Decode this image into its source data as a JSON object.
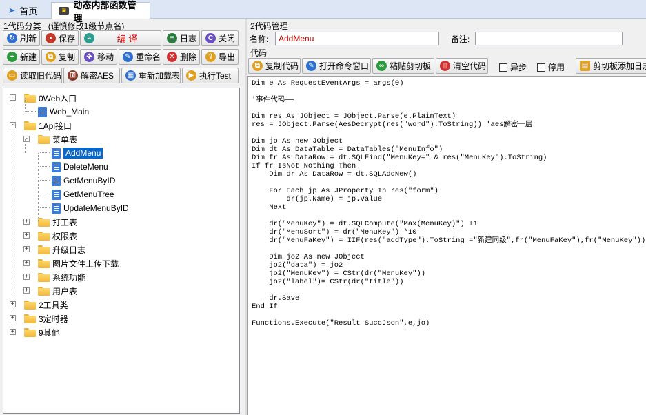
{
  "tabs": [
    {
      "label": "首页",
      "icon": "home-icon"
    },
    {
      "label": "动态内部函数管理",
      "icon": "module-icon"
    }
  ],
  "left": {
    "title": "1代码分类",
    "hint": "(谨慎修改1级节点名)",
    "row1": [
      {
        "label": "刷新",
        "icon": "refresh-icon",
        "color": "#2f6fd0"
      },
      {
        "label": "保存",
        "icon": "save-icon",
        "color": "#c0392b"
      },
      {
        "label": "编  译",
        "icon": "compile-icon",
        "color": "#2a9d8f",
        "accent": "#d00000"
      },
      {
        "label": "日志",
        "icon": "log-icon",
        "color": "#2b7a3d"
      },
      {
        "label": "关闭",
        "icon": "close-icon",
        "color": "#6a4fc0"
      }
    ],
    "row2": [
      {
        "label": "新建",
        "icon": "plus-icon",
        "color": "#2a9a3a"
      },
      {
        "label": "复制",
        "icon": "copy-icon",
        "color": "#e0a020"
      },
      {
        "label": "移动",
        "icon": "move-icon",
        "color": "#6a4fc0"
      },
      {
        "label": "重命名",
        "icon": "rename-icon",
        "color": "#2f6fd0"
      },
      {
        "label": "删除",
        "icon": "delete-icon",
        "color": "#d03030"
      },
      {
        "label": "导出",
        "icon": "export-icon",
        "color": "#e0a020"
      }
    ],
    "row3": [
      {
        "label": "读取旧代码",
        "icon": "folder-open-icon",
        "color": "#e0a020"
      },
      {
        "label": "解密AES",
        "icon": "decrypt-icon",
        "color": "#8a3a2a"
      },
      {
        "label": "重新加载表",
        "icon": "reload-table-icon",
        "color": "#2f6fd0"
      },
      {
        "label": "执行Test",
        "icon": "run-icon",
        "color": "#e0a020"
      }
    ],
    "tree": [
      {
        "label": "0Web入口",
        "level": 0,
        "type": "folder",
        "expander": "-"
      },
      {
        "label": "Web_Main",
        "level": 1,
        "type": "doc",
        "expander": ""
      },
      {
        "label": "1Api接口",
        "level": 0,
        "type": "folder",
        "expander": "-"
      },
      {
        "label": "菜单表",
        "level": 1,
        "type": "folder",
        "expander": "-"
      },
      {
        "label": "AddMenu",
        "level": 2,
        "type": "doc",
        "expander": "",
        "selected": true
      },
      {
        "label": "DeleteMenu",
        "level": 2,
        "type": "doc",
        "expander": ""
      },
      {
        "label": "GetMenuByID",
        "level": 2,
        "type": "doc",
        "expander": ""
      },
      {
        "label": "GetMenuTree",
        "level": 2,
        "type": "doc",
        "expander": ""
      },
      {
        "label": "UpdateMenuByID",
        "level": 2,
        "type": "doc",
        "expander": ""
      },
      {
        "label": "打工表",
        "level": 1,
        "type": "folder",
        "expander": "+"
      },
      {
        "label": "权限表",
        "level": 1,
        "type": "folder",
        "expander": "+"
      },
      {
        "label": "升级日志",
        "level": 1,
        "type": "folder",
        "expander": "+"
      },
      {
        "label": "图片文件上传下载",
        "level": 1,
        "type": "folder",
        "expander": "+"
      },
      {
        "label": "系统功能",
        "level": 1,
        "type": "folder",
        "expander": "+"
      },
      {
        "label": "用户表",
        "level": 1,
        "type": "folder",
        "expander": "+"
      },
      {
        "label": "2工具类",
        "level": 0,
        "type": "folder",
        "expander": "+"
      },
      {
        "label": "3定时器",
        "level": 0,
        "type": "folder",
        "expander": "+"
      },
      {
        "label": "9其他",
        "level": 0,
        "type": "folder",
        "expander": "+"
      }
    ]
  },
  "right": {
    "title": "2代码管理",
    "name_label": "名称:",
    "name_value": "AddMenu",
    "note_label": "备注:",
    "note_value": "",
    "code_label": "代码",
    "toolbar": [
      {
        "label": "复制代码",
        "icon": "copy-code-icon",
        "color": "#e0a020"
      },
      {
        "label": "打开命令窗口",
        "icon": "terminal-icon",
        "color": "#2f6fd0"
      },
      {
        "label": "粘贴剪切板",
        "icon": "paste-icon",
        "color": "#2a9a3a"
      },
      {
        "label": "清空代码",
        "icon": "trash-icon",
        "color": "#d03030"
      }
    ],
    "async_label": "异步",
    "async_checked": false,
    "disable_label": "停用",
    "disable_checked": false,
    "clipboard_add_label": "剪切板添加日志",
    "code": "Dim e As RequestEventArgs = args(0)\n\n'事件代码——\n\nDim res As JObject = JObject.Parse(e.PlainText)\nres = JObject.Parse(AesDecrypt(res(\"word\").ToString)) 'aes解密一层\n\nDim jo As new JObject\nDim dt As DataTable = DataTables(\"MenuInfo\")\nDim fr As DataRow = dt.SQLFind(\"MenuKey=\" & res(\"MenuKey\").ToString)\nIf fr IsNot Nothing Then\n    Dim dr As DataRow = dt.SQLAddNew()\n\n    For Each jp As JProperty In res(\"form\")\n        dr(jp.Name) = jp.value\n    Next\n\n    dr(\"MenuKey\") = dt.SQLCompute(\"Max(MenuKey)\") +1\n    dr(\"MenuSort\") = dr(\"MenuKey\") *10\n    dr(\"MenuFaKey\") = IIF(res(\"addType\").ToString =\"新建同级\",fr(\"MenuFaKey\"),fr(\"MenuKey\"))\n\n    Dim jo2 As new JObject\n    jo2(\"data\") = jo2\n    jo2(\"MenuKey\") = CStr(dr(\"MenuKey\"))\n    jo2(\"label\")= CStr(dr(\"title\"))\n\n    dr.Save\nEnd If\n\nFunctions.Execute(\"Result_SuccJson\",e,jo)"
  }
}
